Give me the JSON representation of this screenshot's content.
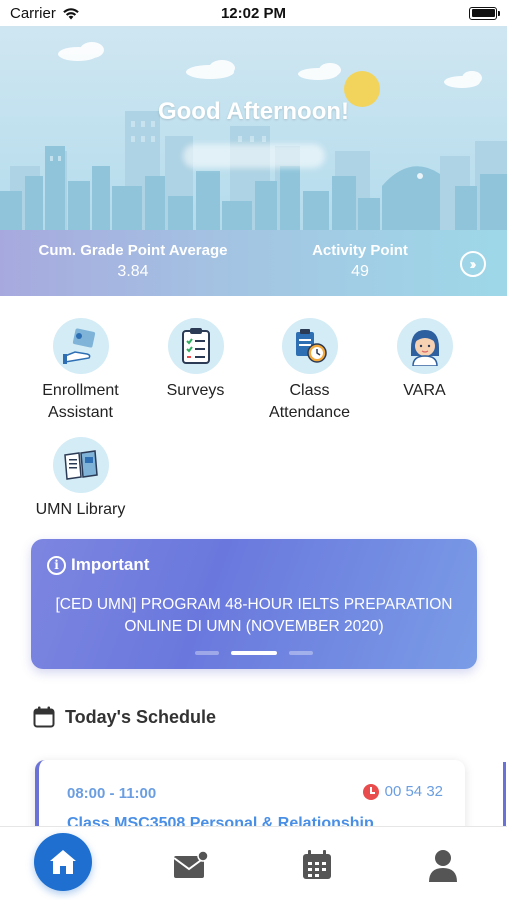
{
  "status_bar": {
    "carrier": "Carrier",
    "time": "12:02 PM"
  },
  "hero": {
    "greeting": "Good Afternoon!",
    "stats": {
      "gpa_label": "Cum. Grade Point Average",
      "gpa_value": "3.84",
      "activity_label": "Activity Point",
      "activity_value": "49"
    }
  },
  "menu": {
    "items": [
      {
        "label": "Enrollment Assistant",
        "icon": "enrollment-icon"
      },
      {
        "label": "Surveys",
        "icon": "clipboard-checklist-icon"
      },
      {
        "label": "Class Attendance",
        "icon": "attendance-stopwatch-icon"
      },
      {
        "label": "VARA",
        "icon": "assistant-avatar-icon"
      },
      {
        "label": "UMN Library",
        "icon": "library-book-icon"
      }
    ]
  },
  "important": {
    "title": "Important",
    "text": "[CED UMN] PROGRAM 48-HOUR IELTS PREPARATION ONLINE DI UMN (NOVEMBER 2020)"
  },
  "schedule": {
    "title": "Today's Schedule",
    "card": {
      "time": "08:00 - 11:00",
      "countdown": "00 54 32",
      "class": "Class MSC3508 Personal & Relationship"
    }
  },
  "tabs": [
    "home-icon",
    "mail-icon",
    "calendar-icon",
    "profile-icon"
  ],
  "colors": {
    "accent": "#1e6fd0",
    "banner": "#6a78dd",
    "schedule_text": "#6b9ee0",
    "countdown_clock": "#e94c4c"
  }
}
